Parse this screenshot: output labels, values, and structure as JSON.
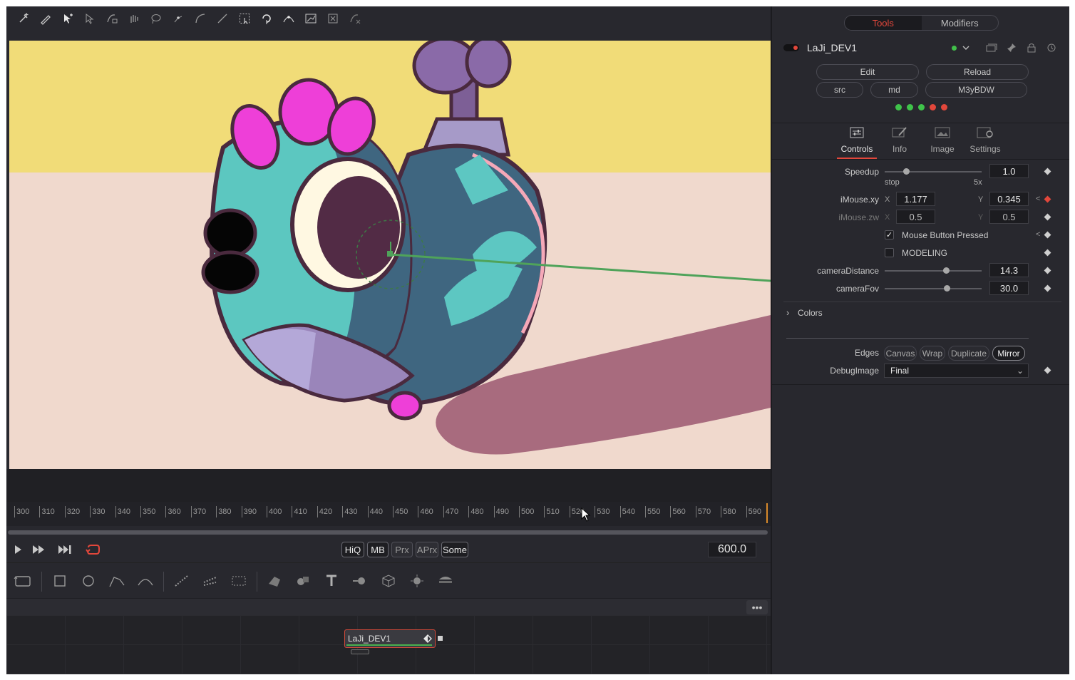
{
  "viewer": {
    "resolution": "1920x1080xfloat16"
  },
  "toolbar_icons": [
    "add-point-icon",
    "pen-icon",
    "select-add-icon",
    "select-icon",
    "lock-select-icon",
    "hand-icon",
    "lasso-icon",
    "point-icon",
    "curve-icon",
    "line-icon",
    "rect-select-icon",
    "rotate-icon",
    "smooth-icon",
    "transform-box-icon",
    "delete-icon",
    "reset-icon"
  ],
  "timeline": {
    "ticks": [
      "300",
      "310",
      "320",
      "330",
      "340",
      "350",
      "360",
      "370",
      "380",
      "390",
      "400",
      "410",
      "420",
      "430",
      "440",
      "450",
      "460",
      "470",
      "480",
      "490",
      "500",
      "510",
      "520",
      "530",
      "540",
      "550",
      "560",
      "570",
      "580",
      "590"
    ],
    "current_time": "600.0"
  },
  "transport": {
    "play_icon": "play-icon",
    "fast_forward_icon": "fast-forward-icon",
    "skip_end_icon": "skip-end-icon",
    "loop_icon": "loop-icon",
    "quality_buttons": [
      {
        "label": "HiQ",
        "active": true
      },
      {
        "label": "MB",
        "active": true
      },
      {
        "label": "Prx",
        "active": false
      },
      {
        "label": "APrx",
        "active": false
      },
      {
        "label": "Some",
        "active": true
      }
    ]
  },
  "tools_bar_icons": [
    "background-icon",
    "rectangle-icon",
    "ellipse-icon",
    "polygon-icon",
    "bspline-icon",
    "particles-emitter-icon",
    "particles-render-icon",
    "particles-pmerge-icon",
    "shape3d-icon",
    "merge3d-icon",
    "text3d-icon",
    "renderer3d-icon",
    "camera3d-icon",
    "light3d-icon",
    "imageplane3d-icon"
  ],
  "flow": {
    "menu_label": "•••",
    "node": {
      "label": "LaJi_DEV1"
    }
  },
  "panel": {
    "tabs": [
      "Tools",
      "Modifiers"
    ],
    "active_tab": "Tools",
    "tool_name": "LaJi_DEV1",
    "buttons": {
      "edit": "Edit",
      "reload": "Reload",
      "src": "src",
      "md": "md",
      "m3ybdw": "M3yBDW"
    },
    "leds": [
      "#3fc34a",
      "#3fc34a",
      "#3fc34a",
      "#e2473b",
      "#e2473b"
    ],
    "control_tabs": [
      "Controls",
      "Info",
      "Image",
      "Settings"
    ],
    "active_control_tab": "Controls",
    "speedup": {
      "label": "Speedup",
      "value": "1.0",
      "min_label": "stop",
      "max_label": "5x",
      "level": 0.22
    },
    "imouse_xy": {
      "label": "iMouse.xy",
      "x_letter": "X",
      "x": "1.177",
      "y_letter": "Y",
      "y": "0.345"
    },
    "imouse_zw": {
      "label": "iMouse.zw",
      "x_letter": "X",
      "x": "0.5",
      "y_letter": "Y",
      "y": "0.5"
    },
    "mouse_button_pressed": {
      "label": "Mouse Button Pressed",
      "checked": true,
      "check_glyph": "✓"
    },
    "modeling": {
      "label": "MODELING",
      "checked": false
    },
    "camera_distance": {
      "label": "cameraDistance",
      "value": "14.3",
      "level": 0.63
    },
    "camera_fov": {
      "label": "cameraFov",
      "value": "30.0",
      "level": 0.64
    },
    "colors_section": {
      "label": "Colors",
      "chevron": "›"
    },
    "edges": {
      "label": "Edges",
      "options": [
        "Canvas",
        "Wrap",
        "Duplicate",
        "Mirror"
      ],
      "active": "Mirror"
    },
    "debug_image": {
      "label": "DebugImage",
      "value": "Final",
      "chevron": "⌄"
    },
    "kf_arrow": "<"
  },
  "colors": {
    "accent": "#e2473b",
    "node_border": "#d24a3a",
    "active_led": "#3fc34a"
  }
}
